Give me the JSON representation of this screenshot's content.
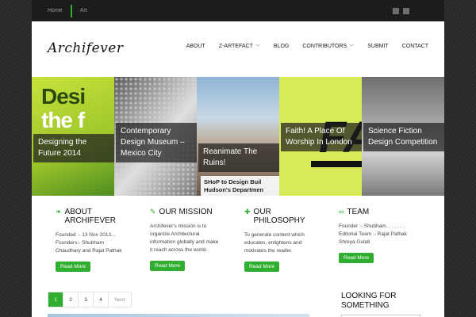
{
  "topbar": {
    "links": [
      "Home",
      "Art"
    ],
    "social_icons": [
      "twitter-icon",
      "facebook-icon"
    ]
  },
  "header": {
    "logo": "Archifever",
    "nav": [
      {
        "label": "ABOUT",
        "has_dropdown": false
      },
      {
        "label": "Z-ARTEFACT",
        "has_dropdown": true
      },
      {
        "label": "BLOG",
        "has_dropdown": false
      },
      {
        "label": "CONTRIBUTORS",
        "has_dropdown": true
      },
      {
        "label": "SUBMIT",
        "has_dropdown": false
      },
      {
        "label": "CONTACT",
        "has_dropdown": false
      }
    ]
  },
  "slider": {
    "slides": [
      {
        "caption": "Designing the Future 2014",
        "art_text": [
          "Desi",
          "the f"
        ]
      },
      {
        "caption": "Contemporary Design Museum – Mexico City"
      },
      {
        "caption": "Reanimate The Ruins!",
        "sign_text": [
          "SHoP to Design Buil",
          "Hudson's Departmen"
        ]
      },
      {
        "caption": "Faith! A Place Of Worship In London",
        "art_text": [
          "FA"
        ]
      },
      {
        "caption": "Science Fiction Design Competition"
      }
    ]
  },
  "features": [
    {
      "icon": "leaf-icon",
      "title": "ABOUT ARCHIFEVER",
      "text": "Founded :- 13 Nov 2013... Founders:- Shubham Chaudhary and Rajat Pathak",
      "button": "Read More"
    },
    {
      "icon": "pen-icon",
      "title": "OUR MISSION",
      "text": "Archifever's mission is to organize Architectural information globally and make it reach across the world.",
      "button": "Read More"
    },
    {
      "icon": "puzzle-icon",
      "title": "OUR PHILOSOPHY",
      "text": "To generate content which educates, enlightens and motivates the reader.",
      "button": "Read More"
    },
    {
      "icon": "link-icon",
      "title": "TEAM",
      "text": "Founder :- Shubham. . . . . . . Editorial Team :- Rajat Pathak Shreya Gulati",
      "button": "Read More"
    }
  ],
  "pagination": {
    "pages": [
      "1",
      "2",
      "3",
      "4"
    ],
    "next": "Next",
    "current": "1"
  },
  "sidebar": {
    "title": "LOOKING FOR SOMETHING"
  },
  "colors": {
    "accent": "#2fae2f",
    "topbar": "#1c1c1c"
  }
}
